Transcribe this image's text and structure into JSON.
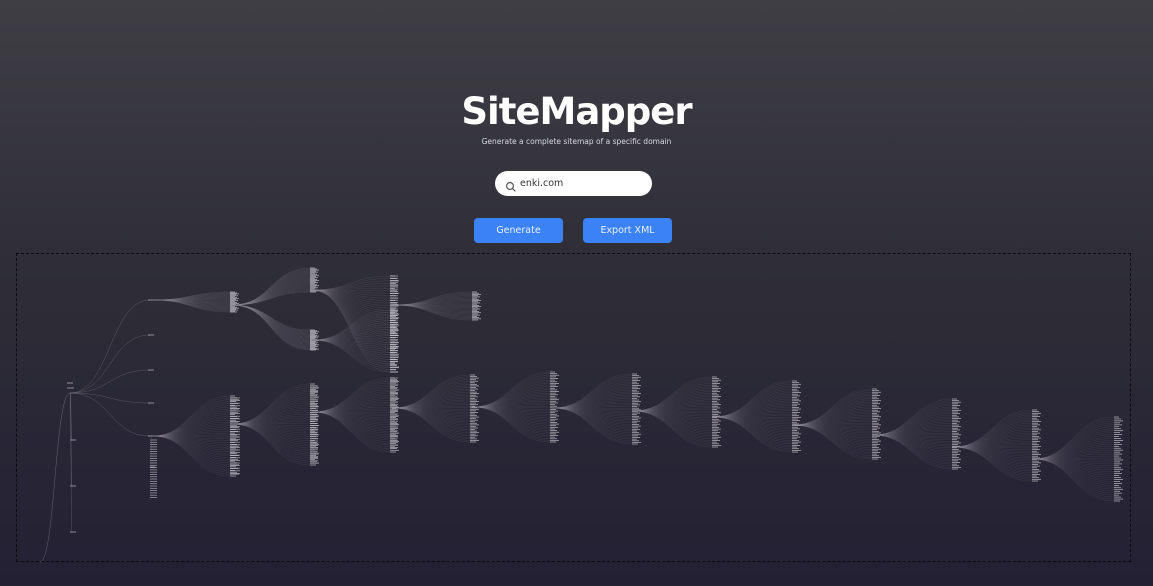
{
  "header": {
    "title": "SiteMapper",
    "subtitle": "Generate a complete sitemap of a specific domain"
  },
  "search": {
    "value": "enki.com",
    "icon": "search-icon"
  },
  "actions": {
    "generate_label": "Generate",
    "export_label": "Export XML"
  },
  "colors": {
    "button": "#3b82f6",
    "tree_link": "#8a8794",
    "tree_label": "#c9c7d0"
  }
}
